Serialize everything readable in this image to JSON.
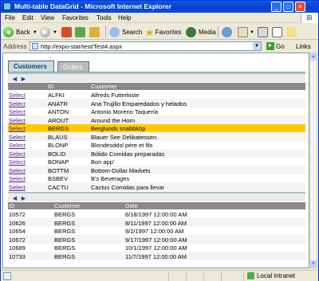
{
  "window": {
    "title": "Multi-table DataGrid - Microsoft Internet Explorer",
    "min_glyph": "_",
    "max_glyph": "□",
    "close_glyph": "×"
  },
  "menu": [
    "File",
    "Edit",
    "View",
    "Favorites",
    "Tools",
    "Help"
  ],
  "toolbar": {
    "back_label": "Back",
    "search_label": "Search",
    "favorites_label": "Favorites",
    "media_label": "Media"
  },
  "address": {
    "label": "Address",
    "url": "http://expo-star/test/Test4.aspx",
    "go_label": "Go",
    "links_label": "Links"
  },
  "tabs": [
    {
      "label": "Customers",
      "active": true
    },
    {
      "label": "Orders",
      "active": false
    }
  ],
  "customers": {
    "nav_prev": "◄",
    "nav_next": "►",
    "columns": [
      "ID",
      "Customer"
    ],
    "select_label": "Select",
    "highlighted_id": "BERGS",
    "rows": [
      {
        "id": "ALFKI",
        "name": "Alfreds Futterkiste"
      },
      {
        "id": "ANATR",
        "name": "Ana Trujillo Emparedados y helados"
      },
      {
        "id": "ANTON",
        "name": "Antonio Moreno Taquería"
      },
      {
        "id": "AROUT",
        "name": "Around the Horn"
      },
      {
        "id": "BERGS",
        "name": "Berglunds snabbköp"
      },
      {
        "id": "BLAUS",
        "name": "Blauer See Delikatessen"
      },
      {
        "id": "BLONP",
        "name": "Blondesddsl père et fils"
      },
      {
        "id": "BOLID",
        "name": "Bólido Comidas preparadas"
      },
      {
        "id": "BONAP",
        "name": "Bon app'"
      },
      {
        "id": "BOTTM",
        "name": "Bottom-Dollar Markets"
      },
      {
        "id": "BSBEV",
        "name": "B's Beverages"
      },
      {
        "id": "CACTU",
        "name": "Cactus Comidas para llevar"
      }
    ]
  },
  "orders": {
    "nav_prev": "◄",
    "nav_next": "►",
    "columns": [
      "ID",
      "Customer",
      "Date"
    ],
    "rows": [
      {
        "id": "10572",
        "customer": "BERGS",
        "date": "6/18/1997 12:00:00 AM"
      },
      {
        "id": "10626",
        "customer": "BERGS",
        "date": "8/11/1997 12:00:00 AM"
      },
      {
        "id": "10654",
        "customer": "BERGS",
        "date": "9/2/1997 12:00:00 AM"
      },
      {
        "id": "10672",
        "customer": "BERGS",
        "date": "9/17/1997 12:00:00 AM"
      },
      {
        "id": "10689",
        "customer": "BERGS",
        "date": "10/1/1997 12:00:00 AM"
      },
      {
        "id": "10733",
        "customer": "BERGS",
        "date": "11/7/1997 12:00:00 AM"
      }
    ]
  },
  "status": {
    "zone_label": "Local intranet"
  }
}
